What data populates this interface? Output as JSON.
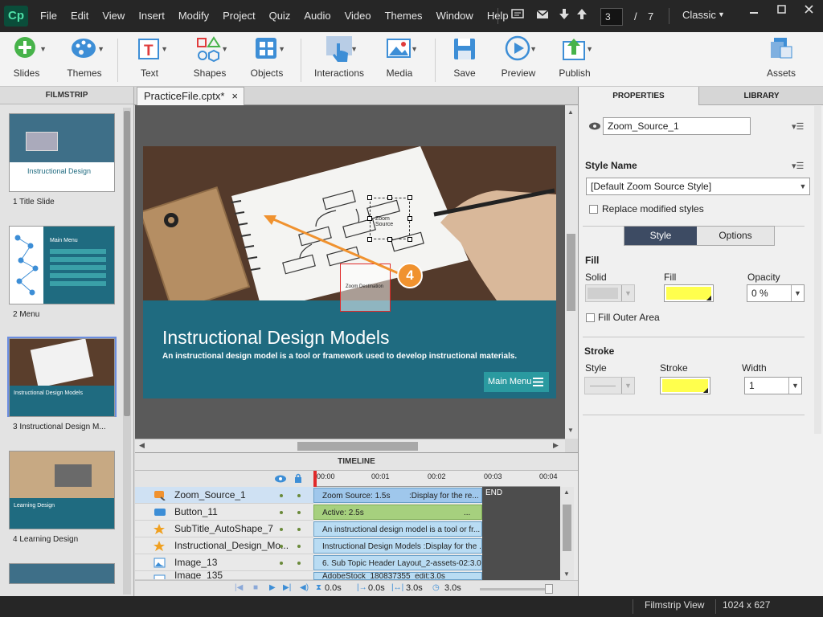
{
  "menubar": {
    "logo": "Cp",
    "menus": [
      "File",
      "Edit",
      "View",
      "Insert",
      "Modify",
      "Project",
      "Quiz",
      "Audio",
      "Video",
      "Themes",
      "Window",
      "Help"
    ],
    "page_current": "3",
    "page_sep": "/",
    "page_total": "7",
    "workspace": "Classic"
  },
  "toolbar": {
    "slides": "Slides",
    "themes": "Themes",
    "text": "Text",
    "shapes": "Shapes",
    "objects": "Objects",
    "interactions": "Interactions",
    "media": "Media",
    "save": "Save",
    "preview": "Preview",
    "publish": "Publish",
    "assets": "Assets"
  },
  "filmstrip": {
    "header": "FILMSTRIP",
    "slides": [
      {
        "label": "1 Title Slide",
        "thumb_title": "Instructional Design"
      },
      {
        "label": "2 Menu",
        "thumb_title": "Main Menu"
      },
      {
        "label": "3 Instructional Design M...",
        "thumb_title": "Instructional Design Models"
      },
      {
        "label": "4 Learning Design",
        "thumb_title": "Learning Design"
      }
    ]
  },
  "doc": {
    "tab": "PracticeFile.cptx*",
    "tab_close": "×"
  },
  "slide": {
    "title": "Instructional Design Models",
    "subtitle": "An instructional design model is a tool or framework used to develop instructional materials.",
    "menu_button": "Main Menu",
    "zoom_source_label": "Zoom Source",
    "zoom_destination_label": "Zoom Destination",
    "callout_number": "4"
  },
  "timeline": {
    "header": "TIMELINE",
    "ticks": [
      "00:00",
      "00:01",
      "00:02",
      "00:03",
      "00:04"
    ],
    "end_label": "END",
    "layers": [
      {
        "name": "Zoom_Source_1",
        "bar": "Zoom Source: 1.5s",
        "bar2": ":Display for the re..."
      },
      {
        "name": "Button_11",
        "bar": "Active: 2.5s",
        "bar2": "..."
      },
      {
        "name": "SubTitle_AutoShape_7",
        "bar": "An instructional design model is a tool or fr...",
        "bar2": ""
      },
      {
        "name": "Instructional_Design_Mo...",
        "bar": "Instructional Design Models :Display for the ...",
        "bar2": ""
      },
      {
        "name": "Image_13",
        "bar": "6. Sub Topic Header Layout_2-assets-02:3.0s",
        "bar2": ""
      },
      {
        "name": "Image_135",
        "bar": "AdobeStock_180837355_edit:3.0s",
        "bar2": ""
      }
    ],
    "time_a": "0.0s",
    "time_b": "0.0s",
    "time_c": "3.0s",
    "time_d": "3.0s"
  },
  "properties": {
    "tab_properties": "PROPERTIES",
    "tab_library": "LIBRARY",
    "object_name": "Zoom_Source_1",
    "style_name_label": "Style Name",
    "style_value": "[Default Zoom Source Style]",
    "replace_label": "Replace modified styles",
    "style_tab": "Style",
    "options_tab": "Options",
    "fill_section": "Fill",
    "solid_label": "Solid",
    "fill_label": "Fill",
    "opacity_label": "Opacity",
    "opacity_value": "0 %",
    "fill_outer_label": "Fill Outer Area",
    "stroke_section": "Stroke",
    "stroke_style_label": "Style",
    "stroke_label": "Stroke",
    "width_label": "Width",
    "width_value": "1",
    "fill_color": "#ffff4d",
    "stroke_color": "#ffff4d"
  },
  "statusbar": {
    "view": "Filmstrip View",
    "size": "1024 x 627"
  },
  "colors": {
    "accent_orange": "#f0922f",
    "slide_teal": "#1f6b80",
    "selection_blue": "#6b8de0"
  }
}
